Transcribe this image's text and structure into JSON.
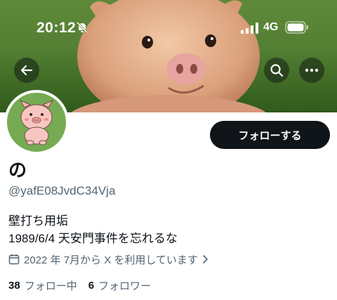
{
  "status_bar": {
    "time": "20:12",
    "network": "4G",
    "icons": [
      "bell-slash-icon",
      "signal-icon",
      "battery-icon"
    ]
  },
  "header": {
    "icons": [
      "back-arrow-icon",
      "search-icon",
      "more-icon"
    ]
  },
  "profile": {
    "display_name": "の",
    "handle": "@yafE08JvdC34Vja",
    "follow_label": "フォローする",
    "bio_lines": [
      "壁打ち用垢",
      "1989/6/4 天安門事件を忘れるな"
    ],
    "joined": "2022 年 7月から X を利用しています",
    "following_count": "38",
    "following_label": "フォロー中",
    "followers_count": "6",
    "followers_label": "フォロワー"
  },
  "colors": {
    "button_bg": "#0f1419",
    "secondary_text": "#536471",
    "avatar_bg": "#76ab53"
  }
}
